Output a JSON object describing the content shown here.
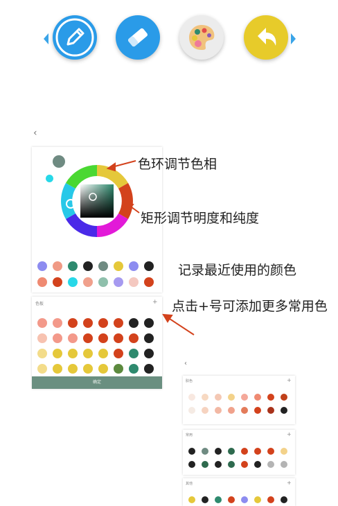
{
  "toolbar": {
    "tools": [
      {
        "icon": "pencil-icon",
        "color": "#2a9be8"
      },
      {
        "icon": "eraser-icon",
        "color": "#2a9be8"
      },
      {
        "icon": "palette-icon",
        "color": "#ececec"
      },
      {
        "icon": "undo-icon",
        "color": "#e7cb2a"
      }
    ]
  },
  "panel_back": "‹",
  "annotations": {
    "hue_ring": "色环调节色相",
    "rect": "矩形调节明度和纯度",
    "recent": "记录最近使用的颜色",
    "add": "点击+号可添加更多常用色"
  },
  "picker": {
    "current_color": "#6f8b82",
    "recent_row1": [
      "#8d8cf0",
      "#f09a85",
      "#2e8a6e",
      "#222222",
      "#6f8b82",
      "#e5c83a",
      "#8d8cf0",
      "#222222"
    ],
    "recent_row2": [
      "#ef8a72",
      "#d3421c",
      "#27d8e8",
      "#f0a08c",
      "#8fc0ac",
      "#a69af0",
      "#f4c8c0",
      "#d3421c"
    ]
  },
  "favorites": {
    "title": "色板",
    "add_label": "+",
    "rows": [
      [
        "#f3998a",
        "#f3998a",
        "#d3421c",
        "#d3421c",
        "#d3421c",
        "#d3421c",
        "#222222",
        "#222222"
      ],
      [
        "#f7c2b0",
        "#f3998a",
        "#f3998a",
        "#d3421c",
        "#d3421c",
        "#d3421c",
        "#d3421c",
        "#222222"
      ],
      [
        "#f3dc8a",
        "#e5c83a",
        "#e5c83a",
        "#e5c83a",
        "#e5c83a",
        "#d3421c",
        "#2e8a6e",
        "#222222"
      ],
      [
        "#f3dc8a",
        "#e5c83a",
        "#e5c83a",
        "#e5c83a",
        "#e5c83a",
        "#5c8a3e",
        "#2e8a6e",
        "#222222"
      ]
    ],
    "confirm": "确定"
  },
  "mini": {
    "back": "‹",
    "sections": [
      {
        "title": "肤色",
        "add": "+",
        "rows": [
          [
            "#f8e8e0",
            "#f7d9c2",
            "#f4c8b4",
            "#f3d28a",
            "#f4a89a",
            "#ef8a72",
            "#d3421c",
            "#c0401a"
          ],
          [
            "#f5ebe4",
            "#f6d3c0",
            "#f2b8a4",
            "#f0a28c",
            "#e37b5a",
            "#d3421c",
            "#a8321a",
            "#222222"
          ]
        ]
      },
      {
        "title": "常用",
        "add": "+",
        "rows": [
          [
            "#222222",
            "#6f8b82",
            "#222222",
            "#2e6a4e",
            "#d3421c",
            "#d3421c",
            "#d3421c",
            "#f3d28a"
          ],
          [
            "#222222",
            "#2e6a4e",
            "#222222",
            "#2e6a4e",
            "#d3421c",
            "#222222",
            "#b4b4b4",
            "#b4b4b4"
          ]
        ]
      },
      {
        "title": "其他",
        "add": "+",
        "rows": [
          [
            "#e5c83a",
            "#222222",
            "#2e8a6e",
            "#d3421c",
            "#8d8cf0",
            "#e5c83a",
            "#d3421c",
            "#222222"
          ]
        ]
      }
    ]
  }
}
